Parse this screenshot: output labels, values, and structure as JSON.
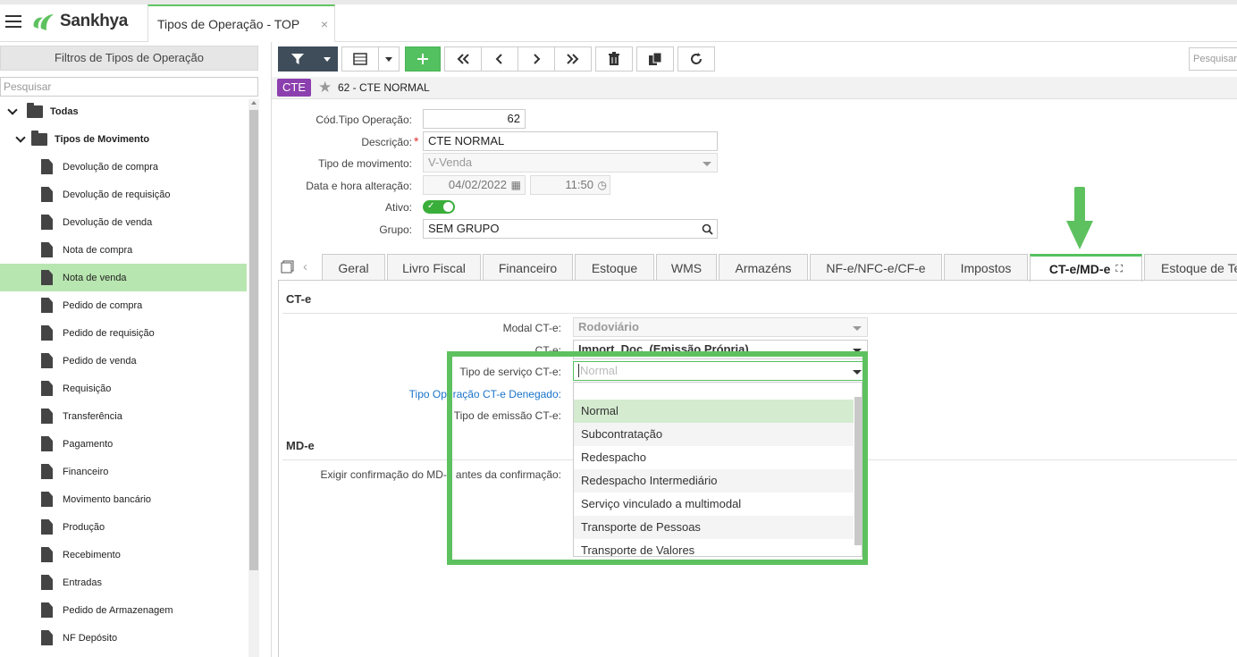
{
  "app": {
    "brand": "Sankhya",
    "tab_title": "Tipos de Operação - TOP",
    "tab_close": "×"
  },
  "left_panel": {
    "header": "Filtros de Tipos de Operação",
    "search_placeholder": "Pesquisar",
    "tree": {
      "root": "Todas",
      "group": "Tipos de Movimento",
      "items": [
        "Devolução de compra",
        "Devolução de requisição",
        "Devolução de venda",
        "Nota de compra",
        "Nota de venda",
        "Pedido de compra",
        "Pedido de requisição",
        "Pedido de venda",
        "Requisição",
        "Transferência",
        "Pagamento",
        "Financeiro",
        "Movimento bancário",
        "Produção",
        "Recebimento",
        "Entradas",
        "Pedido de Armazenagem",
        "NF Depósito"
      ],
      "selected": "Nota de venda"
    }
  },
  "toolbar": {
    "search_placeholder": "Pesquisar",
    "icons": [
      "filter-icon",
      "grid-icon",
      "add-icon",
      "first-icon",
      "prev-icon",
      "next-icon",
      "last-icon",
      "delete-icon",
      "copy-icon",
      "refresh-icon"
    ]
  },
  "record": {
    "badge": "CTE",
    "title": "62 - CTE NORMAL"
  },
  "form": {
    "cod_label": "Cód.Tipo Operação:",
    "cod_value": "62",
    "desc_label": "Descrição:",
    "desc_required": "*",
    "desc_value": "CTE NORMAL",
    "tipo_mov_label": "Tipo de movimento:",
    "tipo_mov_value": "V-Venda",
    "data_label": "Data e hora alteração:",
    "data_value": "04/02/2022",
    "hora_value": "11:50",
    "ativo_label": "Ativo:",
    "ativo_check": "✓",
    "grupo_label": "Grupo:",
    "grupo_value": "SEM GRUPO"
  },
  "tabs": [
    "Geral",
    "Livro Fiscal",
    "Financeiro",
    "Estoque",
    "WMS",
    "Armazéns",
    "NF-e/NFC-e/CF-e",
    "Impostos",
    "CT-e/MD-e",
    "Estoque de Te"
  ],
  "active_tab": "CT-e/MD-e",
  "cte_section": {
    "title": "CT-e",
    "modal_label": "Modal CT-e:",
    "modal_value": "Rodoviário",
    "cte_label": "CT-e:",
    "cte_value": "Import. Doc. (Emissão Própria)",
    "tipo_servico_label": "Tipo de serviço CT-e:",
    "tipo_servico_placeholder": "Normal",
    "tipo_op_denegado_label": "Tipo Operação CT-e Denegado:",
    "tipo_emissao_label": "Tipo de emissão CT-e:"
  },
  "mde_section": {
    "title": "MD-e",
    "exigir_label": "Exigir confirmação do MD-e antes da confirmação:"
  },
  "dropdown": {
    "options": [
      "Normal",
      "Subcontratação",
      "Redespacho",
      "Redespacho Intermediário",
      "Serviço vinculado a multimodal",
      "Transporte de Pessoas",
      "Transporte de Valores"
    ],
    "selected": "Normal"
  },
  "colors": {
    "accent_green": "#5ec15f",
    "badge_purple": "#8c3fae",
    "selected_row": "#b8e6b0",
    "toolbar_dark": "#3f4d5a"
  }
}
